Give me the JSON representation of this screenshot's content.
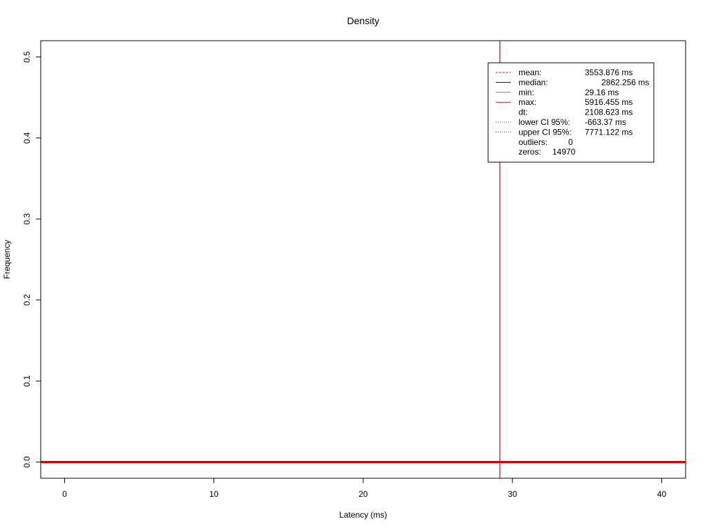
{
  "chart_data": {
    "type": "line",
    "title": "Density",
    "xlabel": "Latency (ms)",
    "ylabel": "Frequency",
    "xlim": [
      -1.6,
      41.6
    ],
    "ylim": [
      -0.02,
      0.52
    ],
    "x_ticks": [
      0,
      10,
      20,
      30,
      40
    ],
    "y_ticks": [
      0.0,
      0.1,
      0.2,
      0.3,
      0.4,
      0.5
    ],
    "x_tick_labels": [
      "0",
      "10",
      "20",
      "30",
      "40"
    ],
    "y_tick_labels": [
      "0.0",
      "0.1",
      "0.2",
      "0.3",
      "0.4",
      "0.5"
    ],
    "grid": false,
    "legend_position": "top-right",
    "series": [
      {
        "color": "#cc0000",
        "x": [
          -1.6,
          41.6
        ],
        "y": [
          0.0,
          0.0
        ]
      }
    ],
    "vertical_lines": [
      {
        "label": "min",
        "x": 29.16,
        "color": "#a52a2a",
        "style": "solid"
      }
    ],
    "legend": [
      {
        "key": "mean:",
        "value": "3553.876 ms",
        "color": "#ff0000",
        "style": "dashed"
      },
      {
        "key": "median:",
        "value": "2862.256 ms",
        "color": "#000080",
        "style": "solid"
      },
      {
        "key": "min:",
        "value": "29.16 ms",
        "color": "#cd5c5c",
        "style": "solid"
      },
      {
        "key": "max:",
        "value": "5916.455 ms",
        "color": "#a52a2a",
        "style": "solid"
      },
      {
        "key": "dt:",
        "value": "2108.623 ms",
        "color": "",
        "style": "none"
      },
      {
        "key": "lower CI 95%:",
        "value": "-663.37 ms",
        "color": "#006400",
        "style": "dotted"
      },
      {
        "key": "upper CI 95%:",
        "value": "7771.122 ms",
        "color": "#006400",
        "style": "dotted"
      },
      {
        "key": "outliers:",
        "value": "0",
        "color": "",
        "style": "none"
      },
      {
        "key": "zeros:",
        "value": "14970",
        "color": "",
        "style": "none"
      }
    ]
  }
}
